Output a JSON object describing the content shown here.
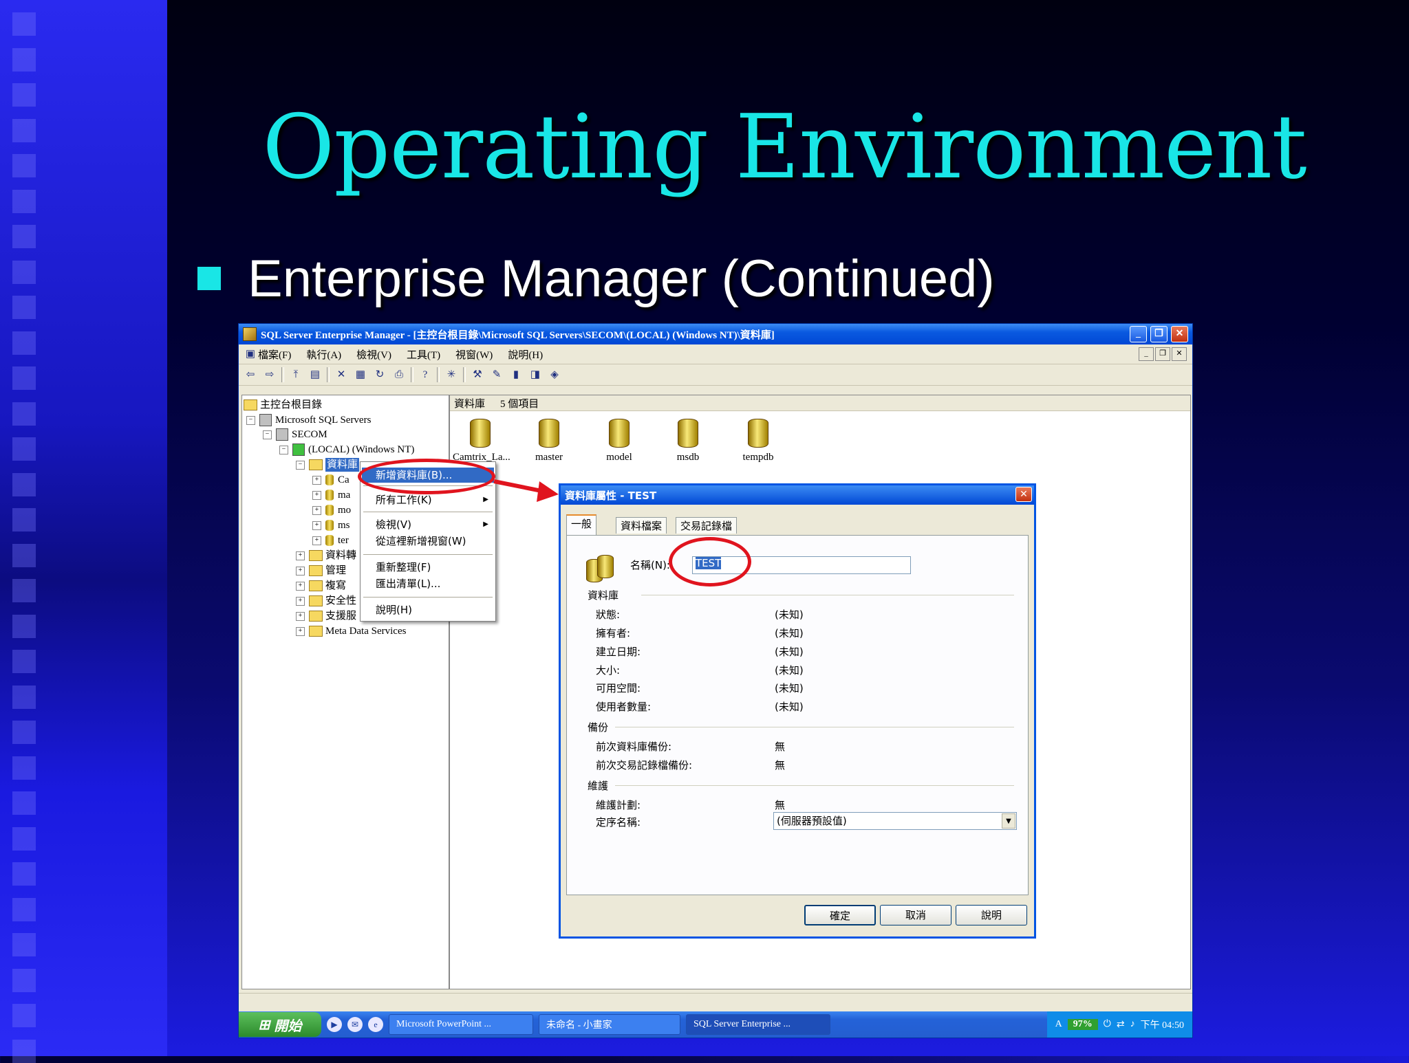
{
  "slide": {
    "title": "Operating Environment",
    "bullet": "Enterprise Manager (Continued)"
  },
  "window": {
    "title": "SQL Server Enterprise Manager - [主控台根目錄\\Microsoft SQL Servers\\SECOM\\(LOCAL) (Windows NT)\\資料庫]",
    "menu": [
      "檔案(F)",
      "執行(A)",
      "檢視(V)",
      "工具(T)",
      "視窗(W)",
      "說明(H)"
    ]
  },
  "tree": {
    "root": "主控台根目錄",
    "servers": "Microsoft SQL Servers",
    "group": "SECOM",
    "instance": "(LOCAL) (Windows NT)",
    "databases": "資料庫",
    "db_children": [
      "Ca",
      "ma",
      "mo",
      "ms",
      "ter"
    ],
    "others": [
      "資料轉",
      "管理",
      "複寫",
      "安全性",
      "支援服"
    ],
    "meta": "Meta Data Services"
  },
  "list": {
    "header_label": "資料庫",
    "header_count": "5 個項目",
    "items": [
      "Camtrix_La...",
      "master",
      "model",
      "msdb",
      "tempdb"
    ]
  },
  "context_menu": {
    "new_db": "新增資料庫(B)...",
    "all_tasks": "所有工作(K)",
    "view": "檢視(V)",
    "new_window": "從這裡新增視窗(W)",
    "refresh": "重新整理(F)",
    "export": "匯出清單(L)...",
    "help": "說明(H)"
  },
  "dialog": {
    "title": "資料庫屬性 - TEST",
    "tabs": [
      "一般",
      "資料檔案",
      "交易記錄檔"
    ],
    "name_label": "名稱(N):",
    "name_value": "TEST",
    "section_db": "資料庫",
    "db_fields": [
      {
        "label": "狀態:",
        "value": "(未知)"
      },
      {
        "label": "擁有者:",
        "value": "(未知)"
      },
      {
        "label": "建立日期:",
        "value": "(未知)"
      },
      {
        "label": "大小:",
        "value": "(未知)"
      },
      {
        "label": "可用空間:",
        "value": "(未知)"
      },
      {
        "label": "使用者數量:",
        "value": "(未知)"
      }
    ],
    "section_backup": "備份",
    "backup_fields": [
      {
        "label": "前次資料庫備份:",
        "value": "無"
      },
      {
        "label": "前次交易記錄檔備份:",
        "value": "無"
      }
    ],
    "section_maint": "維護",
    "maint_plan_label": "維護計劃:",
    "maint_plan_value": "無",
    "sort_label": "定序名稱:",
    "sort_value": "(伺服器預設值)",
    "ok": "確定",
    "cancel": "取消",
    "help": "說明"
  },
  "taskbar": {
    "start": "開始",
    "tasks": [
      "Microsoft PowerPoint ...",
      "未命名 - 小畫家",
      "SQL Server Enterprise ..."
    ],
    "battery": "97%",
    "clock": "下午 04:50"
  },
  "colors": {
    "title_cyan": "#19e6e6",
    "annotation_red": "#e0141e",
    "xp_blue": "#0054e3"
  }
}
